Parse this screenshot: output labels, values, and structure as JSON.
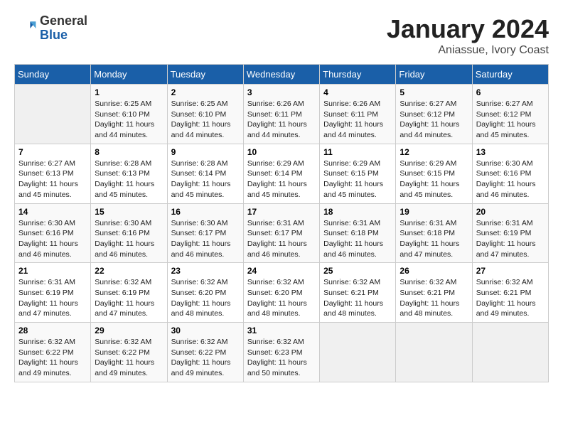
{
  "logo": {
    "general": "General",
    "blue": "Blue"
  },
  "title": {
    "month": "January 2024",
    "location": "Aniassue, Ivory Coast"
  },
  "days_of_week": [
    "Sunday",
    "Monday",
    "Tuesday",
    "Wednesday",
    "Thursday",
    "Friday",
    "Saturday"
  ],
  "weeks": [
    [
      {
        "day": "",
        "info": ""
      },
      {
        "day": "1",
        "info": "Sunrise: 6:25 AM\nSunset: 6:10 PM\nDaylight: 11 hours and 44 minutes."
      },
      {
        "day": "2",
        "info": "Sunrise: 6:25 AM\nSunset: 6:10 PM\nDaylight: 11 hours and 44 minutes."
      },
      {
        "day": "3",
        "info": "Sunrise: 6:26 AM\nSunset: 6:11 PM\nDaylight: 11 hours and 44 minutes."
      },
      {
        "day": "4",
        "info": "Sunrise: 6:26 AM\nSunset: 6:11 PM\nDaylight: 11 hours and 44 minutes."
      },
      {
        "day": "5",
        "info": "Sunrise: 6:27 AM\nSunset: 6:12 PM\nDaylight: 11 hours and 44 minutes."
      },
      {
        "day": "6",
        "info": "Sunrise: 6:27 AM\nSunset: 6:12 PM\nDaylight: 11 hours and 45 minutes."
      }
    ],
    [
      {
        "day": "7",
        "info": "Sunrise: 6:27 AM\nSunset: 6:13 PM\nDaylight: 11 hours and 45 minutes."
      },
      {
        "day": "8",
        "info": "Sunrise: 6:28 AM\nSunset: 6:13 PM\nDaylight: 11 hours and 45 minutes."
      },
      {
        "day": "9",
        "info": "Sunrise: 6:28 AM\nSunset: 6:14 PM\nDaylight: 11 hours and 45 minutes."
      },
      {
        "day": "10",
        "info": "Sunrise: 6:29 AM\nSunset: 6:14 PM\nDaylight: 11 hours and 45 minutes."
      },
      {
        "day": "11",
        "info": "Sunrise: 6:29 AM\nSunset: 6:15 PM\nDaylight: 11 hours and 45 minutes."
      },
      {
        "day": "12",
        "info": "Sunrise: 6:29 AM\nSunset: 6:15 PM\nDaylight: 11 hours and 45 minutes."
      },
      {
        "day": "13",
        "info": "Sunrise: 6:30 AM\nSunset: 6:16 PM\nDaylight: 11 hours and 46 minutes."
      }
    ],
    [
      {
        "day": "14",
        "info": "Sunrise: 6:30 AM\nSunset: 6:16 PM\nDaylight: 11 hours and 46 minutes."
      },
      {
        "day": "15",
        "info": "Sunrise: 6:30 AM\nSunset: 6:16 PM\nDaylight: 11 hours and 46 minutes."
      },
      {
        "day": "16",
        "info": "Sunrise: 6:30 AM\nSunset: 6:17 PM\nDaylight: 11 hours and 46 minutes."
      },
      {
        "day": "17",
        "info": "Sunrise: 6:31 AM\nSunset: 6:17 PM\nDaylight: 11 hours and 46 minutes."
      },
      {
        "day": "18",
        "info": "Sunrise: 6:31 AM\nSunset: 6:18 PM\nDaylight: 11 hours and 46 minutes."
      },
      {
        "day": "19",
        "info": "Sunrise: 6:31 AM\nSunset: 6:18 PM\nDaylight: 11 hours and 47 minutes."
      },
      {
        "day": "20",
        "info": "Sunrise: 6:31 AM\nSunset: 6:19 PM\nDaylight: 11 hours and 47 minutes."
      }
    ],
    [
      {
        "day": "21",
        "info": "Sunrise: 6:31 AM\nSunset: 6:19 PM\nDaylight: 11 hours and 47 minutes."
      },
      {
        "day": "22",
        "info": "Sunrise: 6:32 AM\nSunset: 6:19 PM\nDaylight: 11 hours and 47 minutes."
      },
      {
        "day": "23",
        "info": "Sunrise: 6:32 AM\nSunset: 6:20 PM\nDaylight: 11 hours and 48 minutes."
      },
      {
        "day": "24",
        "info": "Sunrise: 6:32 AM\nSunset: 6:20 PM\nDaylight: 11 hours and 48 minutes."
      },
      {
        "day": "25",
        "info": "Sunrise: 6:32 AM\nSunset: 6:21 PM\nDaylight: 11 hours and 48 minutes."
      },
      {
        "day": "26",
        "info": "Sunrise: 6:32 AM\nSunset: 6:21 PM\nDaylight: 11 hours and 48 minutes."
      },
      {
        "day": "27",
        "info": "Sunrise: 6:32 AM\nSunset: 6:21 PM\nDaylight: 11 hours and 49 minutes."
      }
    ],
    [
      {
        "day": "28",
        "info": "Sunrise: 6:32 AM\nSunset: 6:22 PM\nDaylight: 11 hours and 49 minutes."
      },
      {
        "day": "29",
        "info": "Sunrise: 6:32 AM\nSunset: 6:22 PM\nDaylight: 11 hours and 49 minutes."
      },
      {
        "day": "30",
        "info": "Sunrise: 6:32 AM\nSunset: 6:22 PM\nDaylight: 11 hours and 49 minutes."
      },
      {
        "day": "31",
        "info": "Sunrise: 6:32 AM\nSunset: 6:23 PM\nDaylight: 11 hours and 50 minutes."
      },
      {
        "day": "",
        "info": ""
      },
      {
        "day": "",
        "info": ""
      },
      {
        "day": "",
        "info": ""
      }
    ]
  ]
}
